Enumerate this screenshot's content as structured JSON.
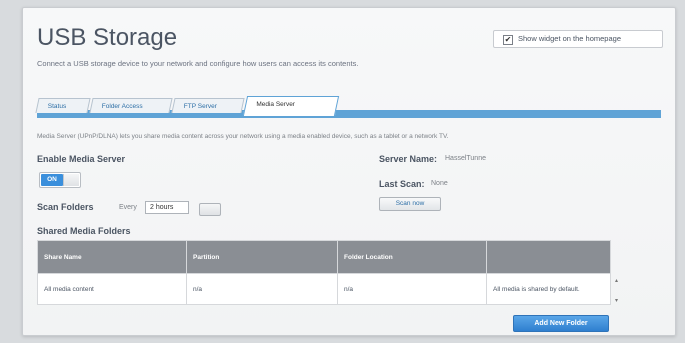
{
  "page": {
    "title": "USB Storage",
    "subtitle": "Connect a USB storage device to your network and configure how users can access its contents.",
    "homepage_checkbox": {
      "label": "Show widget on the homepage",
      "checked": true,
      "check_glyph": "✔"
    }
  },
  "tabs": [
    {
      "label": "Status",
      "active": false
    },
    {
      "label": "Folder Access",
      "active": false
    },
    {
      "label": "FTP Server",
      "active": false
    },
    {
      "label": "Media Server",
      "active": true
    }
  ],
  "media_server": {
    "description": "Media Server (UPnP/DLNA) lets you share media content across your network using a media enabled device, such as a tablet or a network TV.",
    "enable_label": "Enable Media Server",
    "toggle_state_label": "ON",
    "server_name_label": "Server Name:",
    "server_name_value": "HasselTunne",
    "last_scan_label": "Last Scan:",
    "last_scan_value": "None",
    "scan_now_label": "Scan now",
    "scan_folders_label": "Scan Folders",
    "scan_every_label": "Every",
    "scan_interval_value": "2 hours"
  },
  "shared_folders": {
    "title": "Shared Media Folders",
    "columns": [
      "Share Name",
      "Partition",
      "Folder Location",
      ""
    ],
    "rows": [
      [
        "All media content",
        "n/a",
        "n/a",
        "All media is shared by default."
      ]
    ],
    "add_button_label": "Add New Folder"
  },
  "colors": {
    "accent": "#3a8fdc",
    "tab_bar": "#5fa3d6",
    "table_header": "#8a8e94"
  }
}
